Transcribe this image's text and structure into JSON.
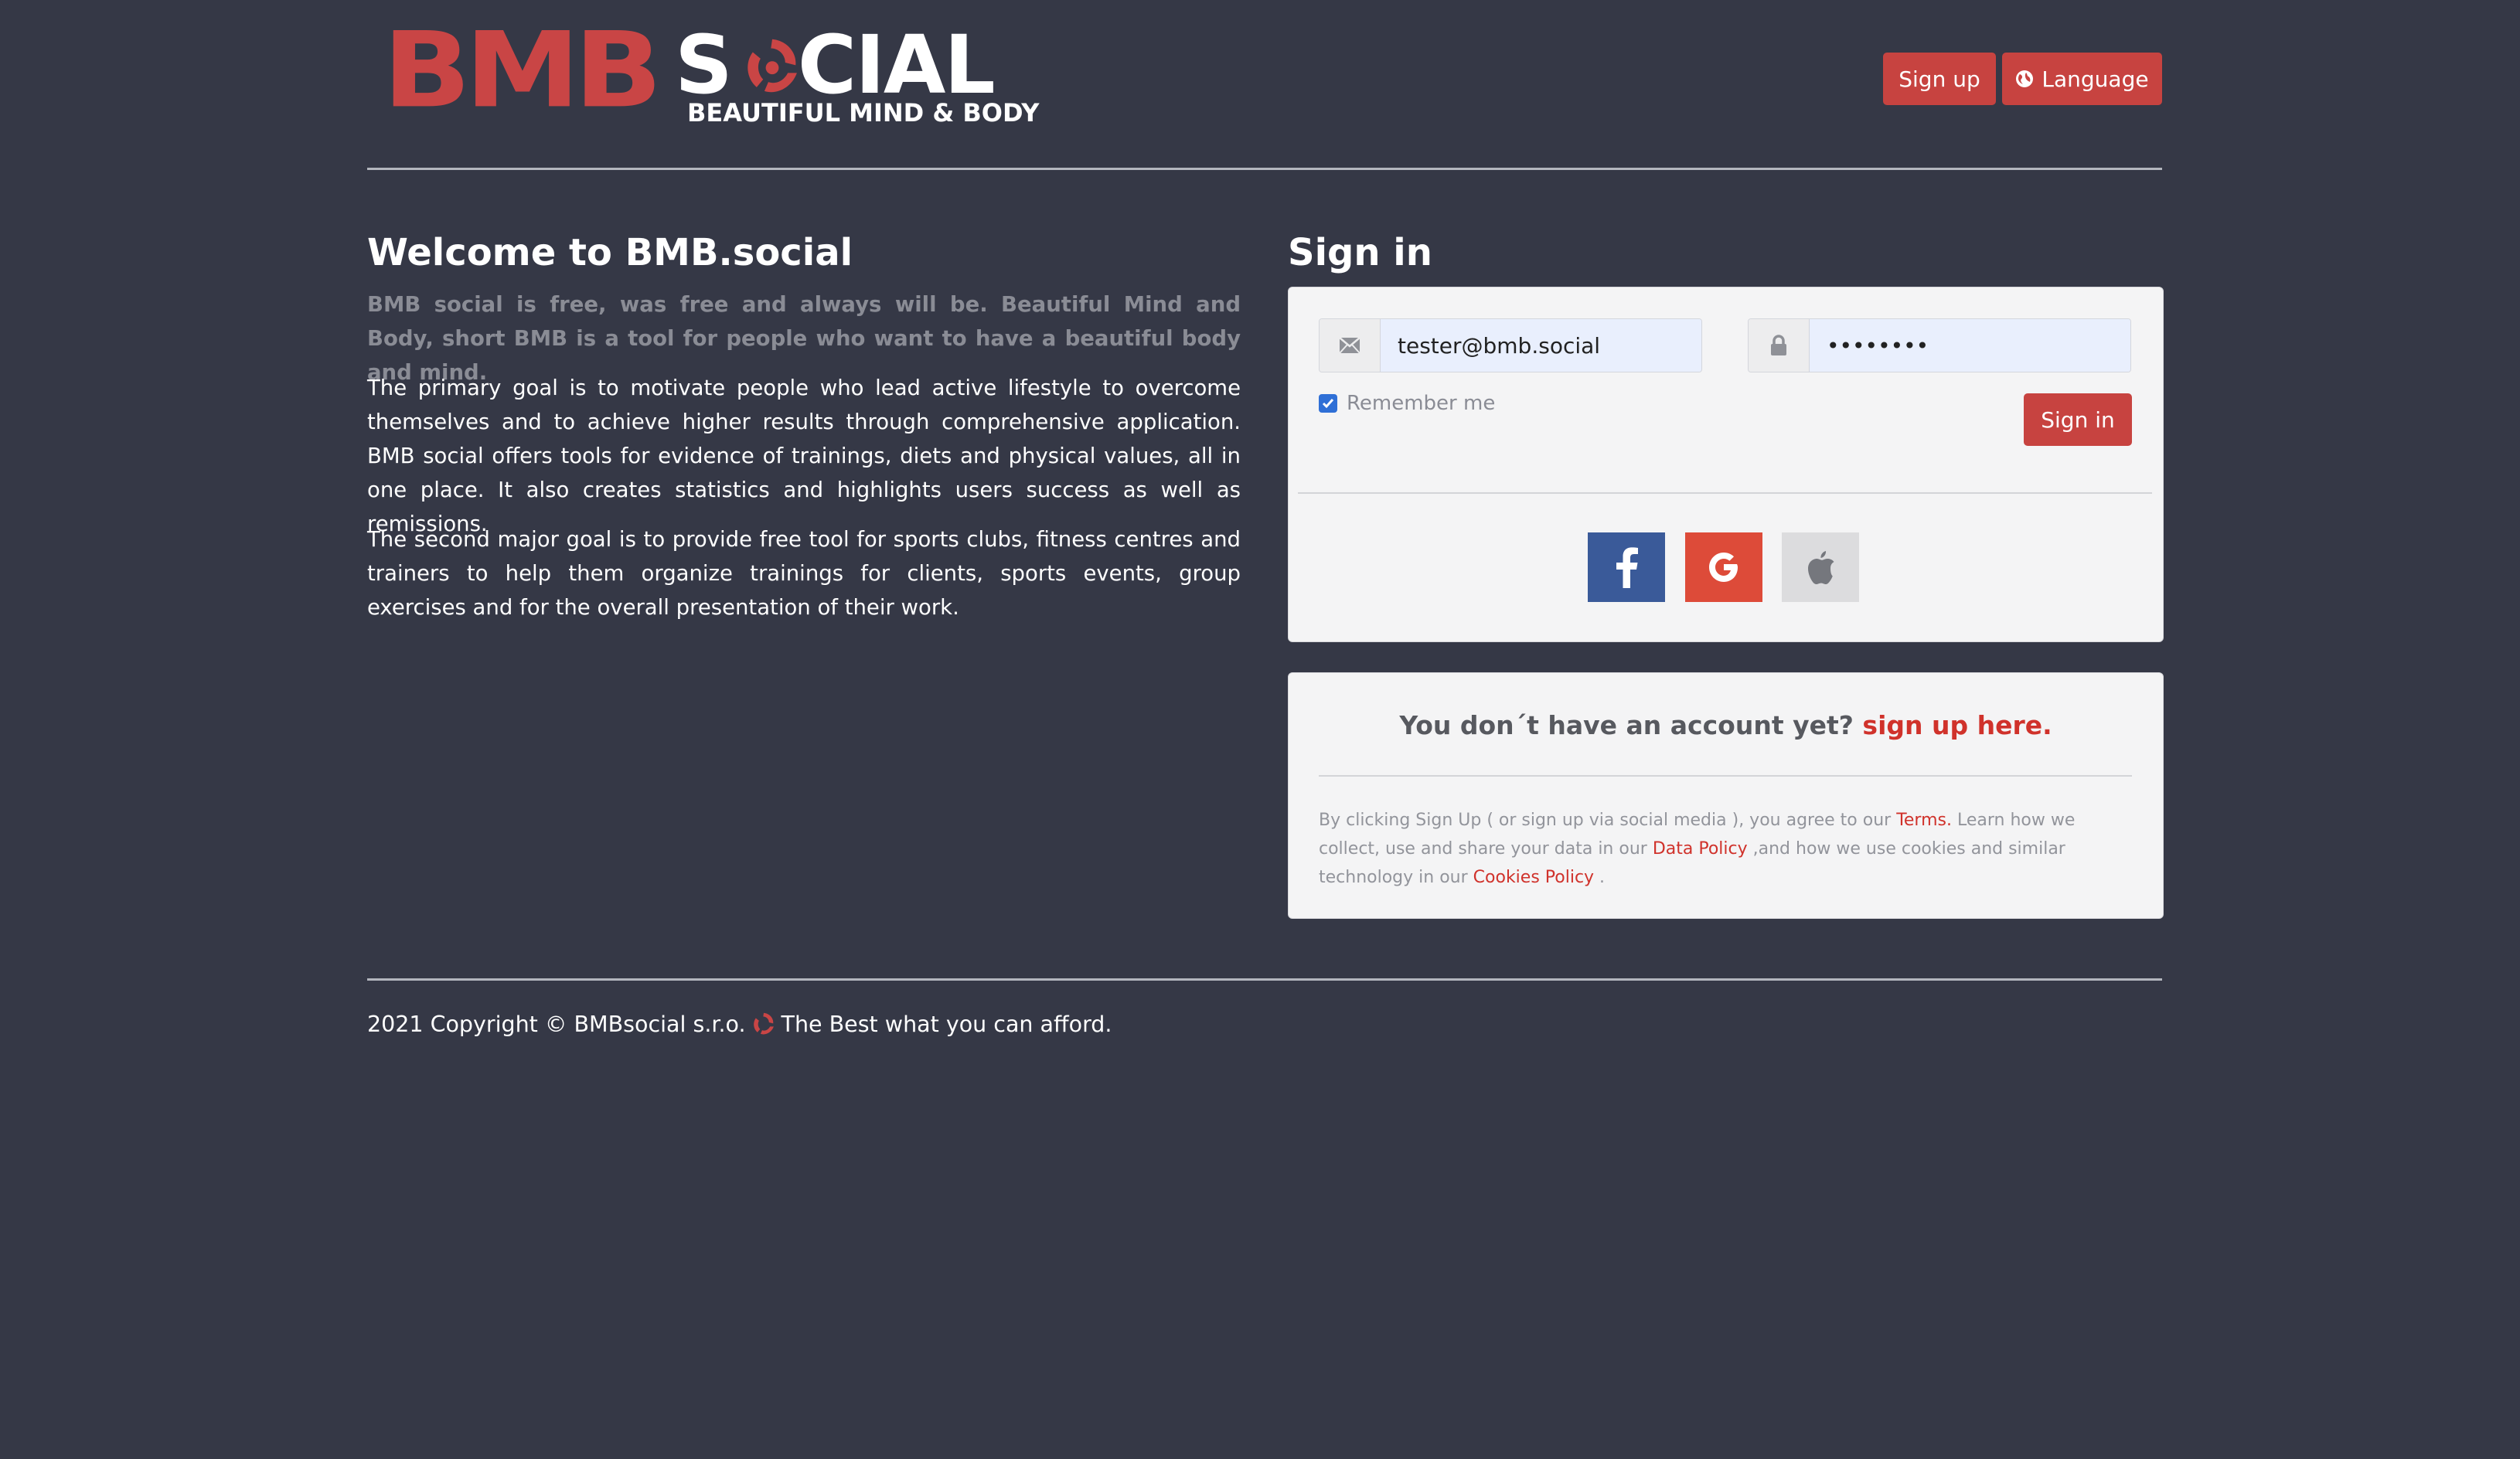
{
  "header": {
    "logo": {
      "part1": "BMB",
      "part2": "S",
      "part3": "CIAL",
      "tagline": "BEAUTIFUL MIND & BODY"
    },
    "signup_label": "Sign up",
    "language_label": "Language"
  },
  "welcome": {
    "title": "Welcome to BMB.social",
    "lead": "BMB social is free, was free and always will be. Beautiful Mind and Body, short BMB is a tool for people who want to have a beautiful body and mind.",
    "paragraph1": "The primary goal is to motivate people who lead active lifestyle to overcome themselves and to achieve higher results through comprehensive application. BMB social offers tools for evidence of trainings, diets and physical values, all in one place. It also creates statistics and highlights users success as well as remissions.",
    "paragraph2": "The second major goal is to provide free tool for sports clubs, fitness centres and trainers to help them organize trainings for clients, sports events, group exercises and for the overall presentation of their work."
  },
  "signin": {
    "title": "Sign in",
    "email_value": "tester@bmb.social",
    "password_value": "••••••••",
    "remember_label": "Remember me",
    "remember_checked": true,
    "button_label": "Sign in",
    "social": [
      "facebook-icon",
      "google-icon",
      "apple-icon"
    ]
  },
  "signup_box": {
    "question": "You don´t have an account yet?",
    "link": "sign up here.",
    "legal_1": "By clicking Sign Up ( or sign up via social media ), you agree to our ",
    "terms": "Terms.",
    "legal_2": " Learn how we collect, use and share your data in our ",
    "data_policy": "Data Policy",
    "legal_3": " ,and how we use cookies and similar technology in our ",
    "cookies_policy": "Cookies Policy",
    "legal_4": " ."
  },
  "footer": {
    "copyright": "2021 Copyright © BMBsocial s.r.o.",
    "slogan": "The Best what you can afford."
  },
  "colors": {
    "background": "#353846",
    "accent": "#c74340",
    "facebook": "#3a5a99",
    "google": "#dd4b39",
    "apple": "#dcdcde"
  }
}
